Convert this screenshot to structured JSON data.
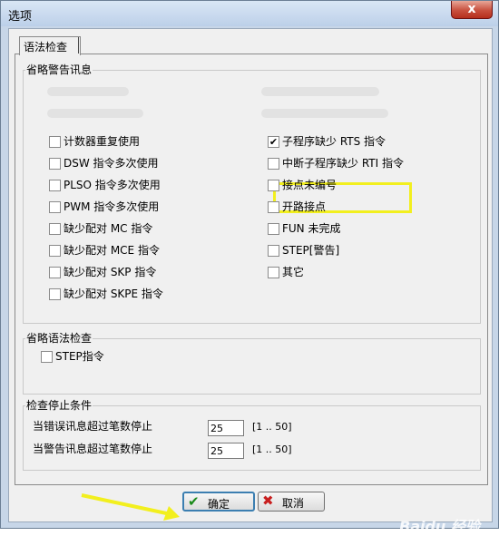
{
  "window": {
    "title": "选项",
    "close_glyph": "x"
  },
  "tab": {
    "label": "语法检查"
  },
  "warnings": {
    "group_title": "省略警告讯息",
    "left": [
      {
        "label": "计数器重复使用",
        "checked": false
      },
      {
        "label": "DSW 指令多次使用",
        "checked": false
      },
      {
        "label": "PLSO 指令多次使用",
        "checked": false
      },
      {
        "label": "PWM 指令多次使用",
        "checked": false
      },
      {
        "label": "缺少配对 MC 指令",
        "checked": false
      },
      {
        "label": "缺少配对 MCE 指令",
        "checked": false
      },
      {
        "label": "缺少配对 SKP 指令",
        "checked": false
      },
      {
        "label": "缺少配对 SKPE 指令",
        "checked": false
      }
    ],
    "right": [
      {
        "label": "子程序缺少 RTS 指令",
        "checked": true
      },
      {
        "label": "中断子程序缺少 RTI 指令",
        "checked": false
      },
      {
        "label": "接点未编号",
        "checked": false
      },
      {
        "label": "开路接点",
        "checked": false
      },
      {
        "label": "FUN 未完成",
        "checked": false
      },
      {
        "label": "STEP[警告]",
        "checked": false
      },
      {
        "label": "其它",
        "checked": false
      }
    ]
  },
  "syntax": {
    "group_title": "省略语法检查",
    "step": {
      "label": "STEP指令",
      "checked": false
    }
  },
  "stop": {
    "group_title": "检查停止条件",
    "error_label": "当错误讯息超过笔数停止",
    "error_value": "25",
    "error_range": "[1 .. 50]",
    "warning_label": "当警告讯息超过笔数停止",
    "warning_value": "25",
    "warning_range": "[1 .. 50]"
  },
  "buttons": {
    "ok": "确定",
    "cancel": "取消"
  },
  "watermark": "Baidu 经验",
  "colors": {
    "highlight": "#f2ef1e",
    "arrow": "#f2ef1e",
    "ok_icon": "#1a8a1a",
    "cancel_icon": "#c81e1e"
  }
}
